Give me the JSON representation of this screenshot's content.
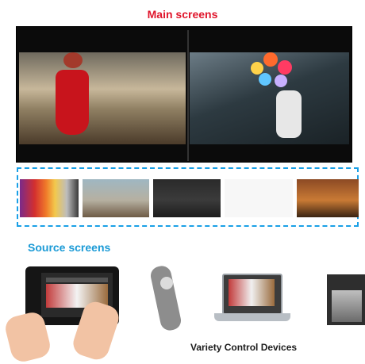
{
  "labels": {
    "main_screens": "Main screens",
    "source_screens": "Source screens",
    "control_devices": "Variety Control Devices"
  },
  "colors": {
    "main_title": "#e0152b",
    "source_title": "#1a9ad6",
    "dashed_border": "#1aa0e6"
  },
  "thumbnails": [
    {
      "name": "colorful-shoes"
    },
    {
      "name": "woman-on-pier"
    },
    {
      "name": "group-in-room"
    },
    {
      "name": "person-white-background"
    },
    {
      "name": "people-at-table"
    }
  ],
  "devices": [
    {
      "name": "tablet-icon"
    },
    {
      "name": "remote-control-icon"
    },
    {
      "name": "laptop-icon"
    },
    {
      "name": "projector-icon"
    }
  ]
}
